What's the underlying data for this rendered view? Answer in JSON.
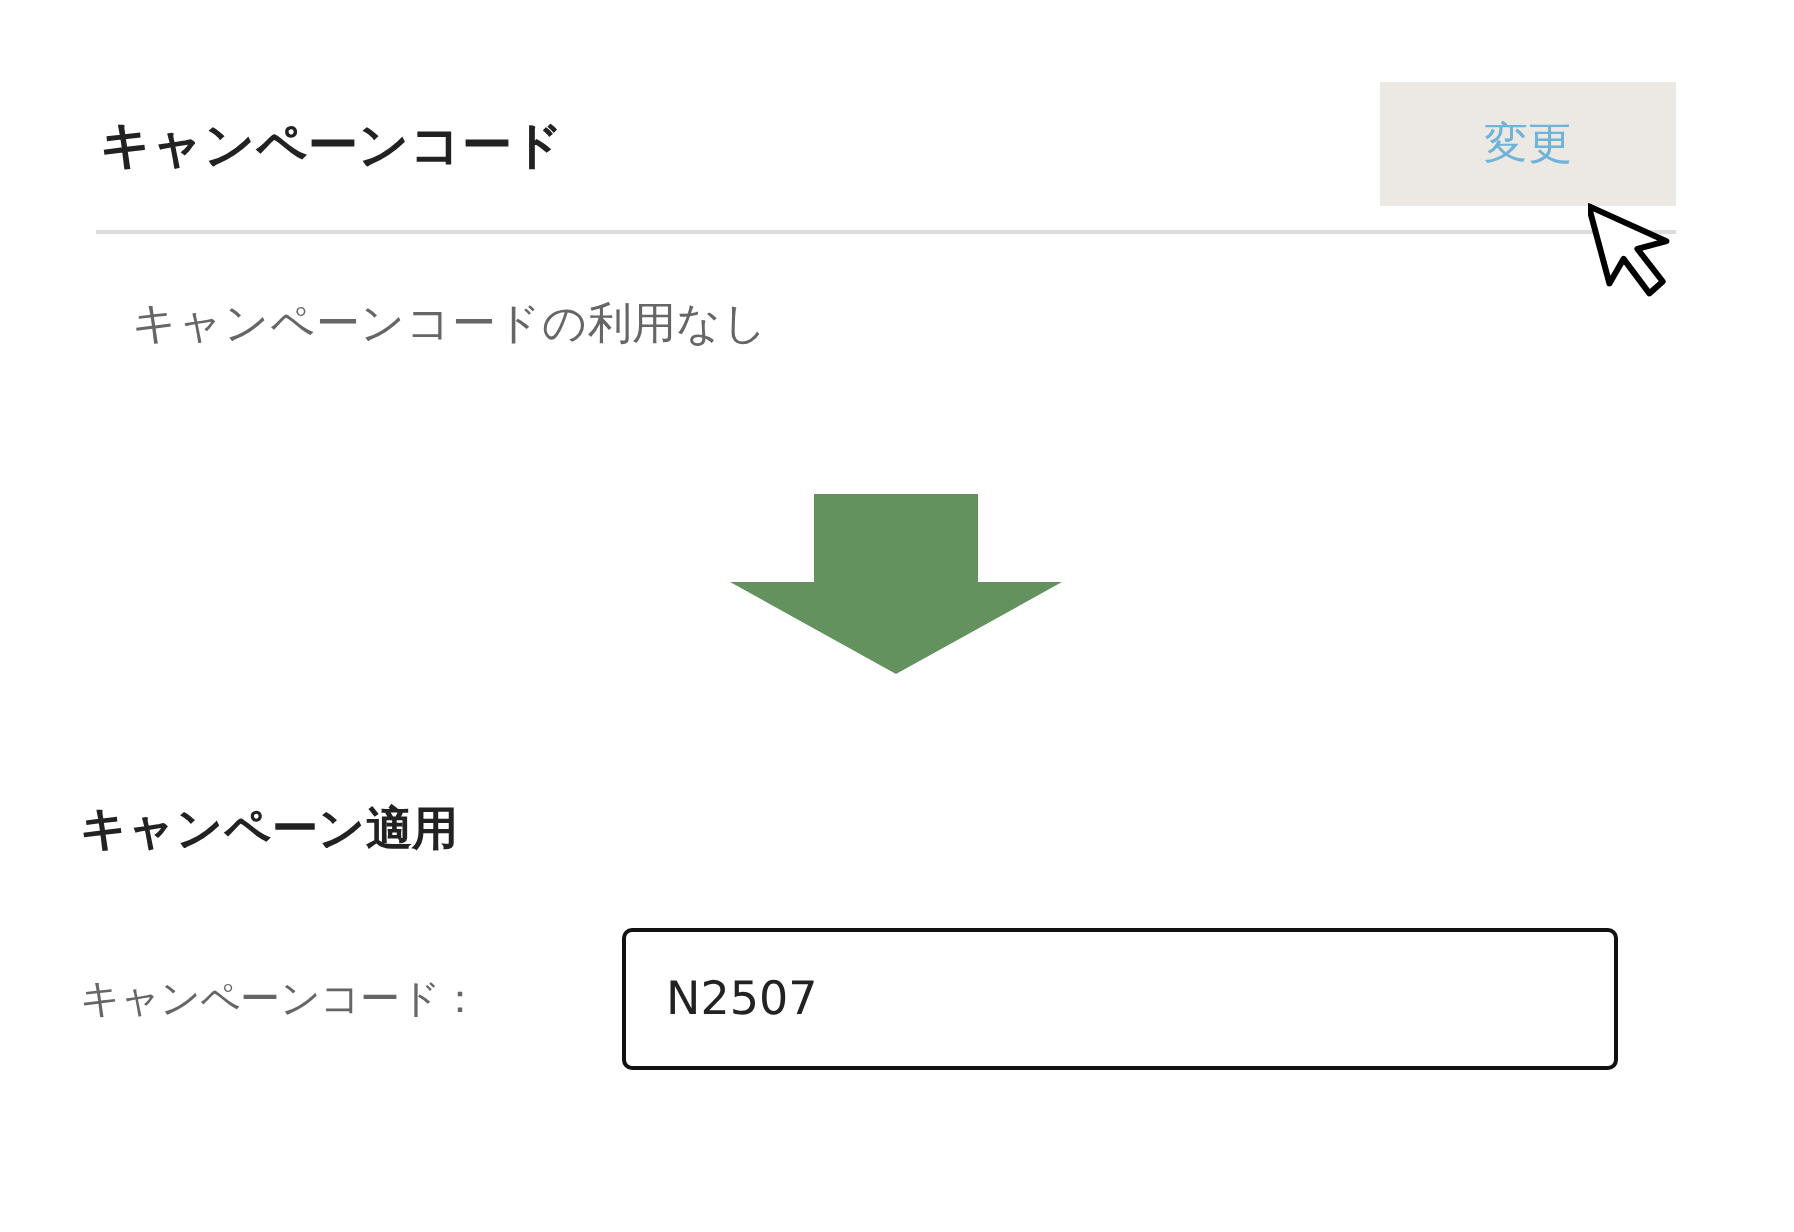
{
  "campaign_code": {
    "title": "キャンペーンコード",
    "change_button": "変更",
    "status": "キャンペーンコードの利用なし"
  },
  "campaign_apply": {
    "title": "キャンペーン適用",
    "field_label": "キャンペーンコード：",
    "value": "N2507"
  }
}
